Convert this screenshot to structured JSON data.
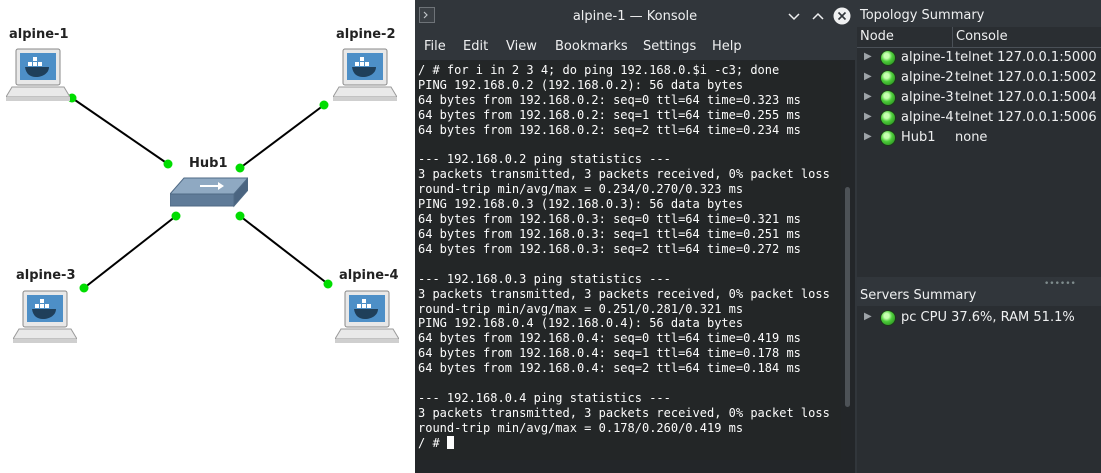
{
  "topology": {
    "nodes": [
      {
        "id": "alpine-1",
        "label": "alpine-1"
      },
      {
        "id": "alpine-2",
        "label": "alpine-2"
      },
      {
        "id": "alpine-3",
        "label": "alpine-3"
      },
      {
        "id": "alpine-4",
        "label": "alpine-4"
      },
      {
        "id": "hub1",
        "label": "Hub1"
      }
    ],
    "link_status_color": "#00dd00"
  },
  "konsole": {
    "title": "alpine-1 — Konsole",
    "menu": [
      "File",
      "Edit",
      "View",
      "Bookmarks",
      "Settings",
      "Help"
    ],
    "terminal_text": "/ # for i in 2 3 4; do ping 192.168.0.$i -c3; done\nPING 192.168.0.2 (192.168.0.2): 56 data bytes\n64 bytes from 192.168.0.2: seq=0 ttl=64 time=0.323 ms\n64 bytes from 192.168.0.2: seq=1 ttl=64 time=0.255 ms\n64 bytes from 192.168.0.2: seq=2 ttl=64 time=0.234 ms\n\n--- 192.168.0.2 ping statistics ---\n3 packets transmitted, 3 packets received, 0% packet loss\nround-trip min/avg/max = 0.234/0.270/0.323 ms\nPING 192.168.0.3 (192.168.0.3): 56 data bytes\n64 bytes from 192.168.0.3: seq=0 ttl=64 time=0.321 ms\n64 bytes from 192.168.0.3: seq=1 ttl=64 time=0.251 ms\n64 bytes from 192.168.0.3: seq=2 ttl=64 time=0.272 ms\n\n--- 192.168.0.3 ping statistics ---\n3 packets transmitted, 3 packets received, 0% packet loss\nround-trip min/avg/max = 0.251/0.281/0.321 ms\nPING 192.168.0.4 (192.168.0.4): 56 data bytes\n64 bytes from 192.168.0.4: seq=0 ttl=64 time=0.419 ms\n64 bytes from 192.168.0.4: seq=1 ttl=64 time=0.178 ms\n64 bytes from 192.168.0.4: seq=2 ttl=64 time=0.184 ms\n\n--- 192.168.0.4 ping statistics ---\n3 packets transmitted, 3 packets received, 0% packet loss\nround-trip min/avg/max = 0.178/0.260/0.419 ms\n",
    "prompt": "/ # "
  },
  "topology_summary": {
    "title": "Topology Summary",
    "columns": [
      "Node",
      "Console"
    ],
    "rows": [
      {
        "node": "alpine-1",
        "console": "telnet 127.0.0.1:5000",
        "status_icon": "green-led-icon"
      },
      {
        "node": "alpine-2",
        "console": "telnet 127.0.0.1:5002",
        "status_icon": "green-led-icon"
      },
      {
        "node": "alpine-3",
        "console": "telnet 127.0.0.1:5004",
        "status_icon": "green-led-icon"
      },
      {
        "node": "alpine-4",
        "console": "telnet 127.0.0.1:5006",
        "status_icon": "green-led-icon"
      },
      {
        "node": "Hub1",
        "console": "none",
        "status_icon": "green-led-icon"
      }
    ]
  },
  "servers_summary": {
    "title": "Servers Summary",
    "rows": [
      {
        "text": "pc CPU 37.6%, RAM 51.1%",
        "status_icon": "green-led-icon"
      }
    ]
  }
}
